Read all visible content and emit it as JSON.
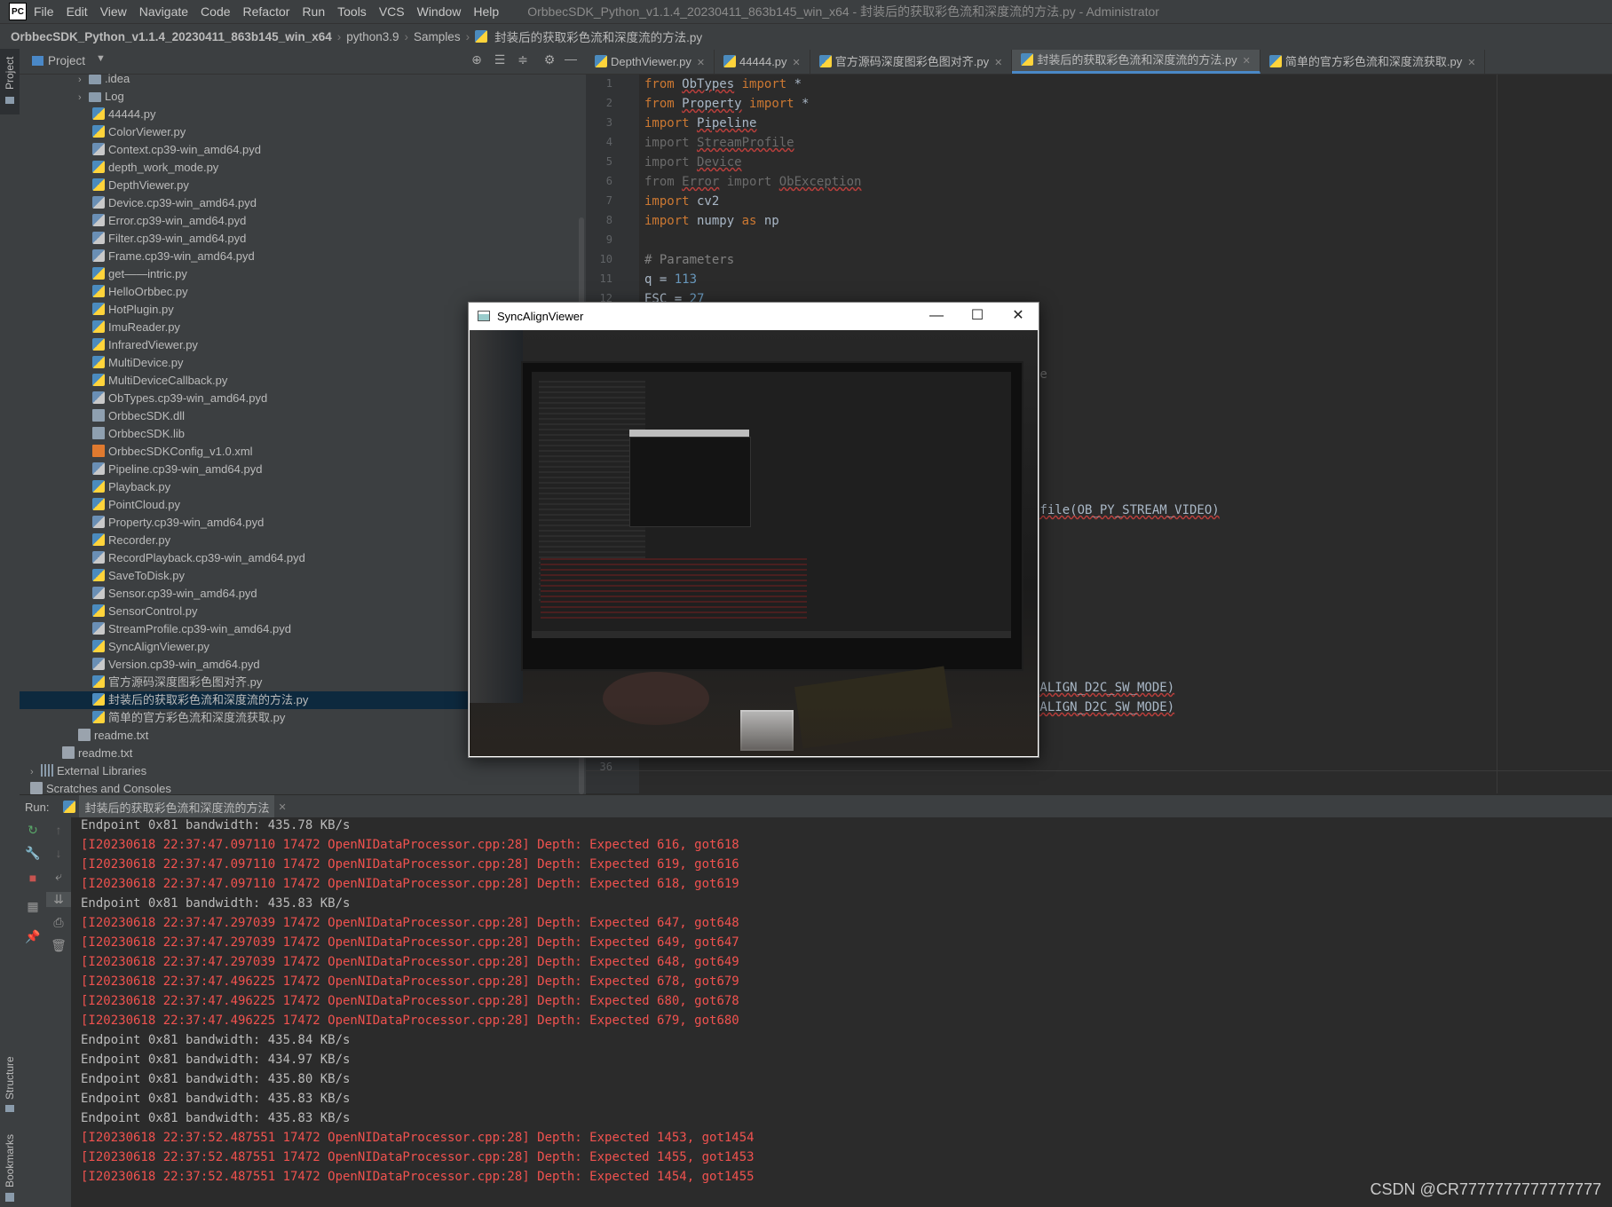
{
  "app": {
    "logo": "PC",
    "window_title": "OrbbecSDK_Python_v1.1.4_20230411_863b145_win_x64 - 封装后的获取彩色流和深度流的方法.py - Administrator",
    "menu": [
      "File",
      "Edit",
      "View",
      "Navigate",
      "Code",
      "Refactor",
      "Run",
      "Tools",
      "VCS",
      "Window",
      "Help"
    ]
  },
  "breadcrumb": [
    "OrbbecSDK_Python_v1.1.4_20230411_863b145_win_x64",
    "python3.9",
    "Samples",
    "封装后的获取彩色流和深度流的方法.py"
  ],
  "left_strip": {
    "project": "Project",
    "structure": "Structure",
    "bookmarks": "Bookmarks"
  },
  "project": {
    "title": "Project",
    "tree": [
      {
        "label": ".idea",
        "type": "folder",
        "depth": 2
      },
      {
        "label": "Log",
        "type": "folder",
        "depth": 2
      },
      {
        "label": "44444.py",
        "type": "py",
        "depth": 3
      },
      {
        "label": "ColorViewer.py",
        "type": "py",
        "depth": 3
      },
      {
        "label": "Context.cp39-win_amd64.pyd",
        "type": "pyd",
        "depth": 3
      },
      {
        "label": "depth_work_mode.py",
        "type": "py",
        "depth": 3
      },
      {
        "label": "DepthViewer.py",
        "type": "py",
        "depth": 3
      },
      {
        "label": "Device.cp39-win_amd64.pyd",
        "type": "pyd",
        "depth": 3
      },
      {
        "label": "Error.cp39-win_amd64.pyd",
        "type": "pyd",
        "depth": 3
      },
      {
        "label": "Filter.cp39-win_amd64.pyd",
        "type": "pyd",
        "depth": 3
      },
      {
        "label": "Frame.cp39-win_amd64.pyd",
        "type": "pyd",
        "depth": 3
      },
      {
        "label": "get——intric.py",
        "type": "py",
        "depth": 3
      },
      {
        "label": "HelloOrbbec.py",
        "type": "py",
        "depth": 3
      },
      {
        "label": "HotPlugin.py",
        "type": "py",
        "depth": 3
      },
      {
        "label": "ImuReader.py",
        "type": "py",
        "depth": 3
      },
      {
        "label": "InfraredViewer.py",
        "type": "py",
        "depth": 3
      },
      {
        "label": "MultiDevice.py",
        "type": "py",
        "depth": 3
      },
      {
        "label": "MultiDeviceCallback.py",
        "type": "py",
        "depth": 3
      },
      {
        "label": "ObTypes.cp39-win_amd64.pyd",
        "type": "pyd",
        "depth": 3
      },
      {
        "label": "OrbbecSDK.dll",
        "type": "dll",
        "depth": 3
      },
      {
        "label": "OrbbecSDK.lib",
        "type": "dll",
        "depth": 3
      },
      {
        "label": "OrbbecSDKConfig_v1.0.xml",
        "type": "xml",
        "depth": 3
      },
      {
        "label": "Pipeline.cp39-win_amd64.pyd",
        "type": "pyd",
        "depth": 3
      },
      {
        "label": "Playback.py",
        "type": "py",
        "depth": 3
      },
      {
        "label": "PointCloud.py",
        "type": "py",
        "depth": 3
      },
      {
        "label": "Property.cp39-win_amd64.pyd",
        "type": "pyd",
        "depth": 3
      },
      {
        "label": "Recorder.py",
        "type": "py",
        "depth": 3
      },
      {
        "label": "RecordPlayback.cp39-win_amd64.pyd",
        "type": "pyd",
        "depth": 3
      },
      {
        "label": "SaveToDisk.py",
        "type": "py",
        "depth": 3
      },
      {
        "label": "Sensor.cp39-win_amd64.pyd",
        "type": "pyd",
        "depth": 3
      },
      {
        "label": "SensorControl.py",
        "type": "py",
        "depth": 3
      },
      {
        "label": "StreamProfile.cp39-win_amd64.pyd",
        "type": "pyd",
        "depth": 3
      },
      {
        "label": "SyncAlignViewer.py",
        "type": "py",
        "depth": 3
      },
      {
        "label": "Version.cp39-win_amd64.pyd",
        "type": "pyd",
        "depth": 3
      },
      {
        "label": "官方源码深度图彩色图对齐.py",
        "type": "py",
        "depth": 3
      },
      {
        "label": "封装后的获取彩色流和深度流的方法.py",
        "type": "py",
        "depth": 3,
        "selected": true
      },
      {
        "label": "简单的官方彩色流和深度流获取.py",
        "type": "py",
        "depth": 3
      },
      {
        "label": "readme.txt",
        "type": "txt",
        "depth": 2
      },
      {
        "label": "readme.txt",
        "type": "txt",
        "depth": 1
      },
      {
        "label": "External Libraries",
        "type": "lib",
        "depth": 0
      },
      {
        "label": "Scratches and Consoles",
        "type": "scratch",
        "depth": 0
      }
    ]
  },
  "tabs": [
    {
      "label": "DepthViewer.py",
      "active": false
    },
    {
      "label": "44444.py",
      "active": false
    },
    {
      "label": "官方源码深度图彩色图对齐.py",
      "active": false
    },
    {
      "label": "封装后的获取彩色流和深度流的方法.py",
      "active": true
    },
    {
      "label": "简单的官方彩色流和深度流获取.py",
      "active": false
    }
  ],
  "editor": {
    "line_numbers": [
      "1",
      "2",
      "3",
      "4",
      "5",
      "6",
      "7",
      "8",
      "9",
      "10",
      "11",
      "12",
      "36"
    ],
    "fragments": {
      "f1": "ne",
      "f2": "ofile(OB_PY_STREAM_VIDEO)",
      "f3": "_ALIGN_D2C_SW_MODE)",
      "f4": "_ALIGN_D2C_SW_MODE)"
    }
  },
  "sync_window": {
    "title": "SyncAlignViewer"
  },
  "run": {
    "label": "Run:",
    "config": "封装后的获取彩色流和深度流的方法",
    "logs": [
      {
        "text": "Endpoint 0x81 bandwidth: 435.78 KB/s",
        "level": "info"
      },
      {
        "text": "[I20230618 22:37:47.097110 17472 OpenNIDataProcessor.cpp:28] Depth: Expected 616, got618",
        "level": "err"
      },
      {
        "text": "[I20230618 22:37:47.097110 17472 OpenNIDataProcessor.cpp:28] Depth: Expected 619, got616",
        "level": "err"
      },
      {
        "text": "[I20230618 22:37:47.097110 17472 OpenNIDataProcessor.cpp:28] Depth: Expected 618, got619",
        "level": "err"
      },
      {
        "text": "Endpoint 0x81 bandwidth: 435.83 KB/s",
        "level": "info"
      },
      {
        "text": "[I20230618 22:37:47.297039 17472 OpenNIDataProcessor.cpp:28] Depth: Expected 647, got648",
        "level": "err"
      },
      {
        "text": "[I20230618 22:37:47.297039 17472 OpenNIDataProcessor.cpp:28] Depth: Expected 649, got647",
        "level": "err"
      },
      {
        "text": "[I20230618 22:37:47.297039 17472 OpenNIDataProcessor.cpp:28] Depth: Expected 648, got649",
        "level": "err"
      },
      {
        "text": "[I20230618 22:37:47.496225 17472 OpenNIDataProcessor.cpp:28] Depth: Expected 678, got679",
        "level": "err"
      },
      {
        "text": "[I20230618 22:37:47.496225 17472 OpenNIDataProcessor.cpp:28] Depth: Expected 680, got678",
        "level": "err"
      },
      {
        "text": "[I20230618 22:37:47.496225 17472 OpenNIDataProcessor.cpp:28] Depth: Expected 679, got680",
        "level": "err"
      },
      {
        "text": "Endpoint 0x81 bandwidth: 435.84 KB/s",
        "level": "info"
      },
      {
        "text": "Endpoint 0x81 bandwidth: 434.97 KB/s",
        "level": "info"
      },
      {
        "text": "Endpoint 0x81 bandwidth: 435.80 KB/s",
        "level": "info"
      },
      {
        "text": "Endpoint 0x81 bandwidth: 435.83 KB/s",
        "level": "info"
      },
      {
        "text": "Endpoint 0x81 bandwidth: 435.83 KB/s",
        "level": "info"
      },
      {
        "text": "[I20230618 22:37:52.487551 17472 OpenNIDataProcessor.cpp:28] Depth: Expected 1453, got1454",
        "level": "err"
      },
      {
        "text": "[I20230618 22:37:52.487551 17472 OpenNIDataProcessor.cpp:28] Depth: Expected 1455, got1453",
        "level": "err"
      },
      {
        "text": "[I20230618 22:37:52.487551 17472 OpenNIDataProcessor.cpp:28] Depth: Expected 1454, got1455",
        "level": "err"
      }
    ]
  },
  "watermark": "CSDN @CR7777777777777777"
}
